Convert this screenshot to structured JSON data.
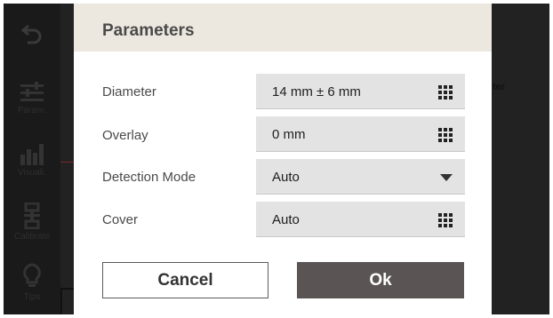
{
  "sidebar": {
    "items": [
      {
        "icon": "back-arrow-icon",
        "label": ""
      },
      {
        "icon": "sliders-icon",
        "label": "Param."
      },
      {
        "icon": "bar-chart-icon",
        "label": "Visuali."
      },
      {
        "icon": "calibrate-icon",
        "label": "Calibrate"
      },
      {
        "icon": "lightbulb-icon",
        "label": "Tips"
      }
    ]
  },
  "background": {
    "right_text": "ter"
  },
  "dialog": {
    "title": "Parameters",
    "rows": [
      {
        "label": "Diameter",
        "value": "14 mm ± 6 mm",
        "control": "keypad-icon"
      },
      {
        "label": "Overlay",
        "value": "0 mm",
        "control": "keypad-icon"
      },
      {
        "label": "Detection Mode",
        "value": "Auto",
        "control": "dropdown-arrow-icon"
      },
      {
        "label": "Cover",
        "value": "Auto",
        "control": "keypad-icon"
      }
    ],
    "cancel_label": "Cancel",
    "ok_label": "Ok"
  },
  "colors": {
    "header_bg": "#ede8df",
    "field_bg": "#e3e3e3",
    "ok_bg": "#5a5454",
    "overlay_bg": "#262626"
  }
}
